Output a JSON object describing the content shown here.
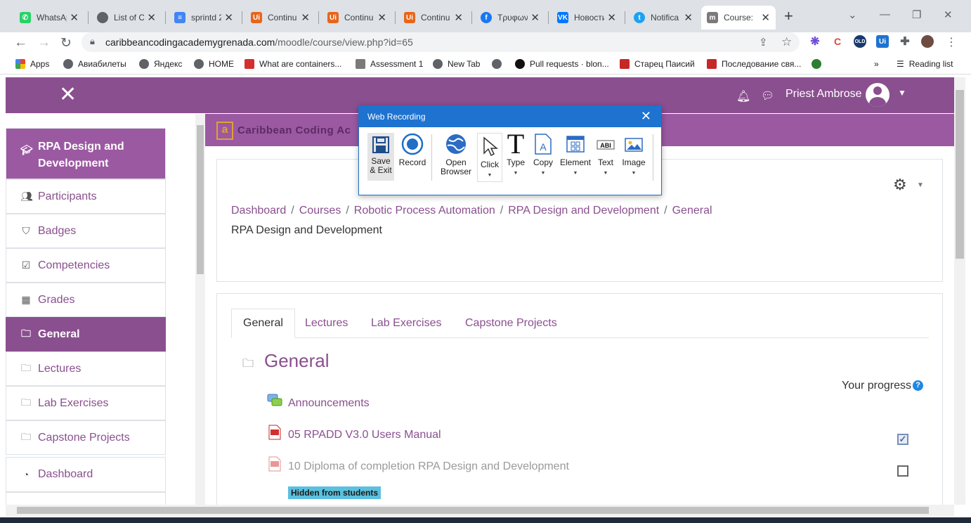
{
  "browser": {
    "tabs": [
      {
        "title": "WhatsApp",
        "color": "#25d366"
      },
      {
        "title": "List of Co",
        "color": "#5f6368"
      },
      {
        "title": "sprintd 2",
        "color": "#4285f4"
      },
      {
        "title": "Continu",
        "color": "#e8651a"
      },
      {
        "title": "Continu",
        "color": "#e8651a"
      },
      {
        "title": "Continu",
        "color": "#e8651a"
      },
      {
        "title": "Τρυφων",
        "color": "#1877f2"
      },
      {
        "title": "Новости",
        "color": "#0077ff"
      },
      {
        "title": "Notifica",
        "color": "#1da1f2"
      },
      {
        "title": "Course:",
        "color": "#7a7a7a"
      }
    ],
    "url_host": "caribbeancodingacademygrenada.com",
    "url_path": "/moodle/course/view.php?id=65",
    "bookmarks": [
      "Apps",
      "Авиабилеты",
      "Яндекс",
      "HOME",
      "What are containers...",
      "Assessment 1",
      "New Tab",
      "",
      "Pull requests · blon...",
      "Старец Паисий",
      "Последование свя...",
      ""
    ],
    "reading_list": "Reading list",
    "more_bookmarks": "»"
  },
  "moodle": {
    "user_name": "Priest Ambrose",
    "banner_text": "Caribbean Coding Ac",
    "sidebar": [
      {
        "label": "RPA Design and Development",
        "icon": "graduation-cap-icon"
      },
      {
        "label": "Participants",
        "icon": "users-icon"
      },
      {
        "label": "Badges",
        "icon": "shield-icon"
      },
      {
        "label": "Competencies",
        "icon": "check-square-icon"
      },
      {
        "label": "Grades",
        "icon": "table-icon"
      },
      {
        "label": "General",
        "icon": "folder-icon"
      },
      {
        "label": "Lectures",
        "icon": "folder-icon"
      },
      {
        "label": "Lab Exercises",
        "icon": "folder-icon"
      },
      {
        "label": "Capstone Projects",
        "icon": "folder-icon"
      },
      {
        "label": "Dashboard",
        "icon": "tachometer-icon"
      }
    ],
    "breadcrumb": [
      "Dashboard",
      "Courses",
      "Robotic Process Automation",
      "RPA Design and Development",
      "General"
    ],
    "page_subtitle": "RPA Design and Development",
    "content_tabs": [
      "General",
      "Lectures",
      "Lab Exercises",
      "Capstone Projects"
    ],
    "section_title": "General",
    "your_progress": "Your progress",
    "help_mark": "?",
    "activities": [
      {
        "name": "Announcements",
        "icon": "forum-icon",
        "completion": null
      },
      {
        "name": "05 RPADD V3.0 Users Manual",
        "icon": "pdf-icon",
        "completion": true
      },
      {
        "name": "10 Diploma of completion RPA Design and Development",
        "icon": "pdf-icon",
        "completion": false
      }
    ],
    "hidden_badge": "Hidden from students"
  },
  "recorder": {
    "title": "Web Recording",
    "buttons": [
      {
        "label": "Save & Exit",
        "line1": "Save",
        "line2": "& Exit",
        "icon": "floppy-icon"
      },
      {
        "label": "Record",
        "icon": "record-icon"
      },
      {
        "label": "Open Browser",
        "line1": "Open",
        "line2": "Browser",
        "icon": "globe-icon"
      },
      {
        "label": "Click",
        "icon": "cursor-icon"
      },
      {
        "label": "Type",
        "icon": "type-icon"
      },
      {
        "label": "Copy",
        "icon": "copy-icon"
      },
      {
        "label": "Element",
        "icon": "element-icon"
      },
      {
        "label": "Text",
        "icon": "text-icon"
      },
      {
        "label": "Image",
        "icon": "image-icon"
      }
    ]
  },
  "colors": {
    "brand": "#8a4f8f",
    "brand_light": "#9b59a2",
    "recorder_blue": "#1e73d0"
  }
}
